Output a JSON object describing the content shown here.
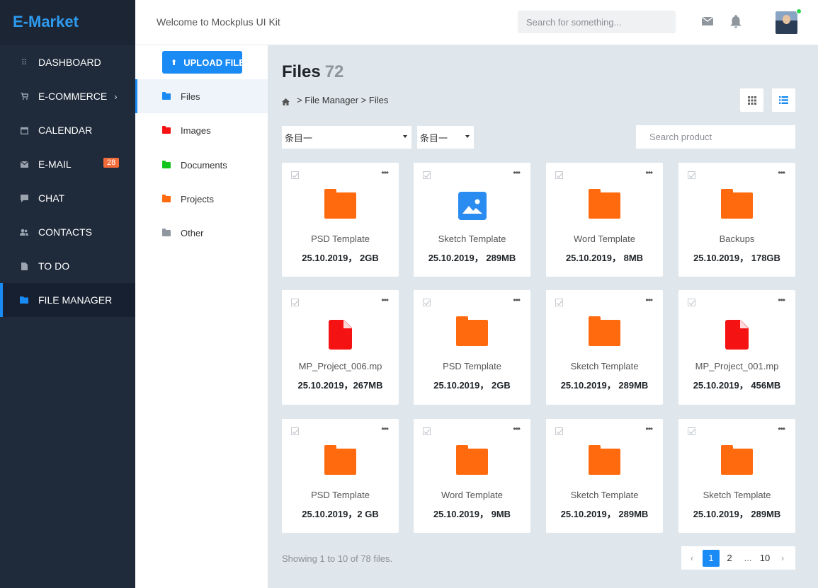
{
  "brand": "E-Market",
  "sidebar": {
    "items": [
      {
        "label": "DASHBOARD",
        "icon": "grid-icon"
      },
      {
        "label": "E-COMMERCE",
        "icon": "cart-icon"
      },
      {
        "label": "CALENDAR",
        "icon": "calendar-icon"
      },
      {
        "label": "E-MAIL",
        "icon": "mail-icon",
        "badge": "28"
      },
      {
        "label": "CHAT",
        "icon": "chat-icon"
      },
      {
        "label": "CONTACTS",
        "icon": "contacts-icon"
      },
      {
        "label": "TO DO",
        "icon": "document-icon"
      },
      {
        "label": "FILE MANAGER",
        "icon": "folder-icon"
      }
    ]
  },
  "header": {
    "welcome": "Welcome to Mockplus UI Kit",
    "search_placeholder": "Search for something..."
  },
  "panel": {
    "upload_label": "UPLOAD FILE",
    "folders": [
      {
        "label": "Files",
        "color": "#1a8bf5"
      },
      {
        "label": "Images",
        "color": "#f51212"
      },
      {
        "label": "Documents",
        "color": "#12c41b"
      },
      {
        "label": "Projects",
        "color": "#ff6a0e"
      },
      {
        "label": "Other",
        "color": "#8f969e"
      }
    ]
  },
  "main": {
    "title": "Files",
    "count": "72",
    "breadcrumb": "> File Manager > Files",
    "select1": "条目一",
    "select2": "条目一",
    "search_placeholder": "Search product",
    "showing": "Showing 1 to 10 of 78 files.",
    "pager": {
      "prev": "‹",
      "p1": "1",
      "p2": "2",
      "dots": "...",
      "last": "10",
      "next": "›"
    }
  },
  "files": [
    {
      "name": "PSD Template",
      "meta": "25.10.2019， 2GB",
      "type": "folder"
    },
    {
      "name": "Sketch Template",
      "meta": "25.10.2019， 289MB",
      "type": "image"
    },
    {
      "name": "Word Template",
      "meta": "25.10.2019， 8MB",
      "type": "folder"
    },
    {
      "name": "Backups",
      "meta": "25.10.2019， 178GB",
      "type": "folder"
    },
    {
      "name": "MP_Project_006.mp",
      "meta": "25.10.2019，267MB",
      "type": "file"
    },
    {
      "name": "PSD Template",
      "meta": "25.10.2019， 2GB",
      "type": "folder"
    },
    {
      "name": "Sketch Template",
      "meta": "25.10.2019， 289MB",
      "type": "folder"
    },
    {
      "name": "MP_Project_001.mp",
      "meta": "25.10.2019， 456MB",
      "type": "file"
    },
    {
      "name": "PSD Template",
      "meta": "25.10.2019，2 GB",
      "type": "folder"
    },
    {
      "name": "Word Template",
      "meta": "25.10.2019， 9MB",
      "type": "folder"
    },
    {
      "name": "Sketch Template",
      "meta": "25.10.2019， 289MB",
      "type": "folder"
    },
    {
      "name": "Sketch Template",
      "meta": "25.10.2019， 289MB",
      "type": "folder"
    }
  ]
}
